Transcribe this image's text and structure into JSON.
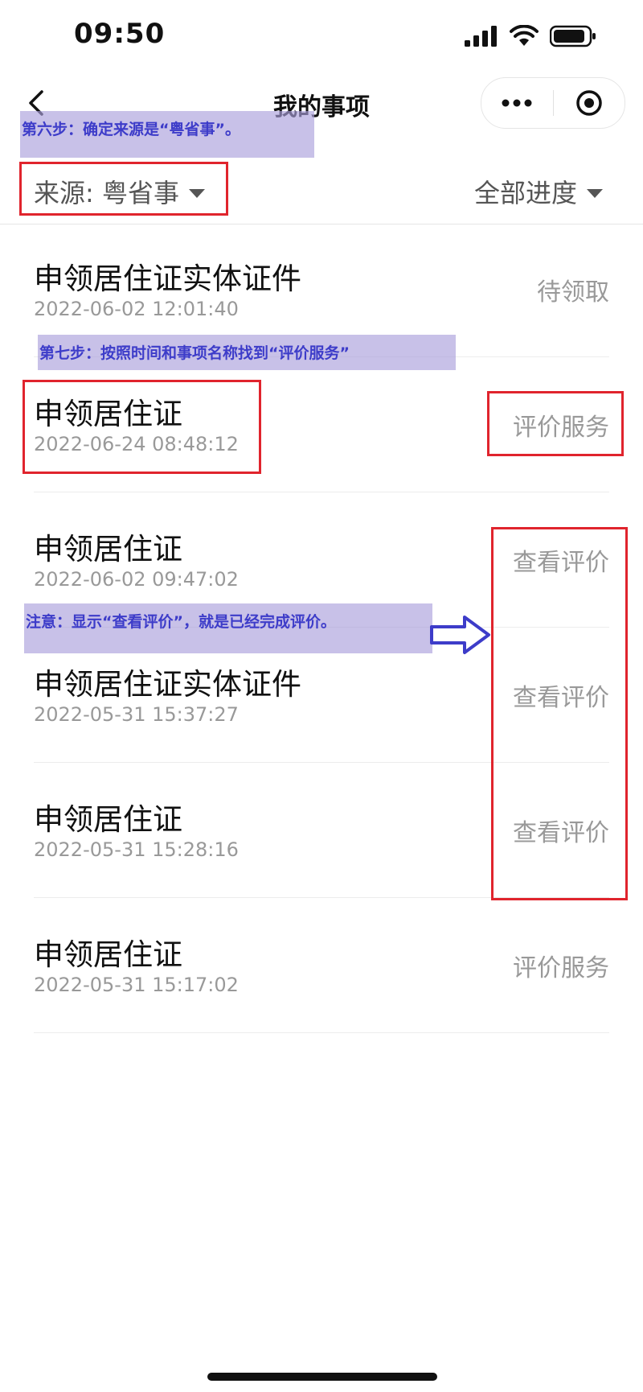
{
  "status_bar": {
    "time": "09:50"
  },
  "nav": {
    "title": "我的事项"
  },
  "filters": {
    "source": "来源: 粤省事",
    "progress": "全部进度"
  },
  "items": [
    {
      "name": "申领居住证实体证件",
      "date": "2022-06-02 12:01:40",
      "status": "待领取"
    },
    {
      "name": "申领居住证",
      "date": "2022-06-24 08:48:12",
      "status": "评价服务"
    },
    {
      "name": "申领居住证",
      "date": "2022-06-02 09:47:02",
      "status": "查看评价"
    },
    {
      "name": "申领居住证实体证件",
      "date": "2022-05-31 15:37:27",
      "status": "查看评价"
    },
    {
      "name": "申领居住证",
      "date": "2022-05-31 15:28:16",
      "status": "查看评价"
    },
    {
      "name": "申领居住证",
      "date": "2022-05-31 15:17:02",
      "status": "评价服务"
    }
  ],
  "annotations": {
    "step6": "第六步：确定来源是“粤省事”。",
    "step7": "第七步：按照时间和事项名称找到“评价服务”",
    "note": "注意：显示“查看评价”，就是已经完成评价。"
  },
  "colors": {
    "annotation_red": "#e0242d",
    "annotation_blue": "#3d3cc9",
    "annotation_bg": "#aaa0dc"
  }
}
